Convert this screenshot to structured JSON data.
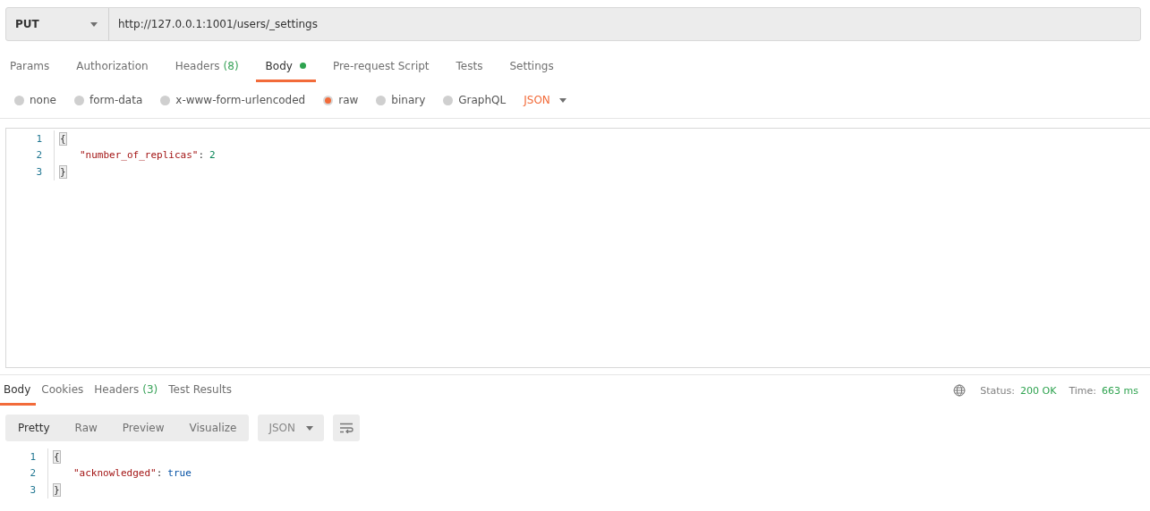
{
  "request": {
    "method": "PUT",
    "url": "http://127.0.0.1:1001/users/_settings"
  },
  "request_tabs": [
    {
      "label": "Params",
      "selected": false,
      "has_content": false
    },
    {
      "label": "Authorization",
      "selected": false,
      "has_content": false
    },
    {
      "label": "Headers",
      "count": "(8)",
      "selected": false,
      "has_content": false
    },
    {
      "label": "Body",
      "selected": true,
      "has_content": true
    },
    {
      "label": "Pre-request Script",
      "selected": false,
      "has_content": false
    },
    {
      "label": "Tests",
      "selected": false,
      "has_content": false
    },
    {
      "label": "Settings",
      "selected": false,
      "has_content": false
    }
  ],
  "body_types": [
    {
      "label": "none",
      "selected": false
    },
    {
      "label": "form-data",
      "selected": false
    },
    {
      "label": "x-www-form-urlencoded",
      "selected": false
    },
    {
      "label": "raw",
      "selected": true
    },
    {
      "label": "binary",
      "selected": false
    },
    {
      "label": "GraphQL",
      "selected": false
    }
  ],
  "body_format": "JSON",
  "request_body": [
    {
      "number": "1",
      "indented": false,
      "tokens": [
        {
          "kind": "brace",
          "text": "{",
          "matched": true
        }
      ]
    },
    {
      "number": "2",
      "indented": true,
      "tokens": [
        {
          "kind": "key",
          "text": "\"number_of_replicas\""
        },
        {
          "kind": "punct",
          "text": ":"
        },
        {
          "kind": "number",
          "text": "2"
        }
      ]
    },
    {
      "number": "3",
      "indented": false,
      "tokens": [
        {
          "kind": "brace",
          "text": "}",
          "matched": true
        }
      ]
    }
  ],
  "response_tabs": [
    {
      "label": "Body",
      "selected": true
    },
    {
      "label": "Cookies",
      "selected": false
    },
    {
      "label": "Headers",
      "count": "(3)",
      "selected": false
    },
    {
      "label": "Test Results",
      "selected": false
    }
  ],
  "status": {
    "status_label": "Status:",
    "status_value": "200 OK",
    "time_label": "Time:",
    "time_value": "663 ms"
  },
  "view_modes": [
    {
      "label": "Pretty",
      "selected": true
    },
    {
      "label": "Raw",
      "selected": false
    },
    {
      "label": "Preview",
      "selected": false
    },
    {
      "label": "Visualize",
      "selected": false
    }
  ],
  "response_format": "JSON",
  "response_body": [
    {
      "number": "1",
      "indented": false,
      "tokens": [
        {
          "kind": "brace",
          "text": "{",
          "matched": true
        }
      ]
    },
    {
      "number": "2",
      "indented": true,
      "tokens": [
        {
          "kind": "key",
          "text": "\"acknowledged\""
        },
        {
          "kind": "punct",
          "text": ":"
        },
        {
          "kind": "boolean",
          "text": "true"
        }
      ]
    },
    {
      "number": "3",
      "indented": false,
      "tokens": [
        {
          "kind": "brace",
          "text": "}",
          "matched": true
        }
      ]
    }
  ]
}
